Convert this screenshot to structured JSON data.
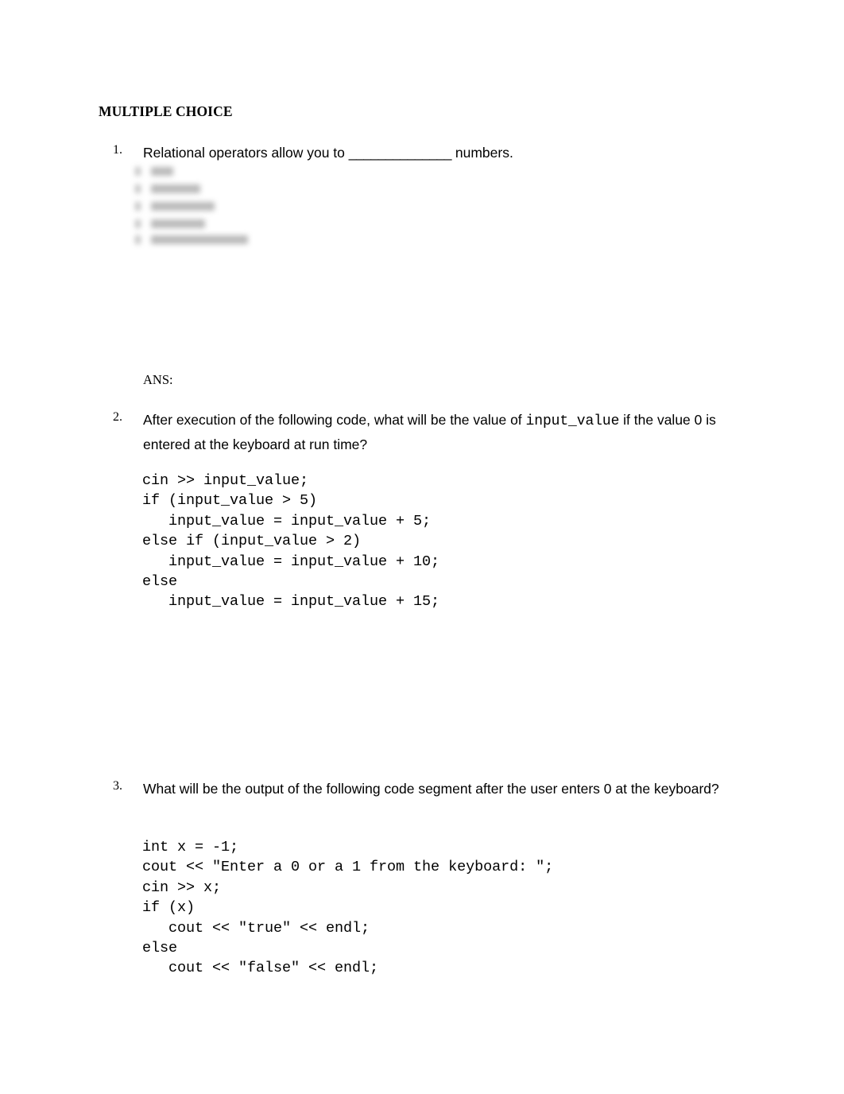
{
  "document": {
    "section_heading": "MULTIPLE CHOICE",
    "questions": [
      {
        "number": "1.",
        "text_before_blank": "Relational operators allow you to ",
        "blank": "______________",
        "text_after_blank": " numbers.",
        "choices_redacted": true,
        "ans_label": "ANS:",
        "ans_value": ""
      },
      {
        "number": "2.",
        "text_part1": "After execution of the following code, what will be the value of ",
        "mono_term": "input_value",
        "text_part2": " if the value 0 is entered at the keyboard at run time?",
        "code": "cin >> input_value;\nif (input_value > 5)\n   input_value = input_value + 5;\nelse if (input_value > 2)\n   input_value = input_value + 10;\nelse\n   input_value = input_value + 15;"
      },
      {
        "number": "3.",
        "text": "What will be the output of the following code segment after the user enters 0 at the keyboard?",
        "code": "int x = -1;\ncout << \"Enter a 0 or a 1 from the keyboard: \";\ncin >> x;\nif (x)\n   cout << \"true\" << endl;\nelse\n   cout << \"false\" << endl;"
      }
    ]
  }
}
